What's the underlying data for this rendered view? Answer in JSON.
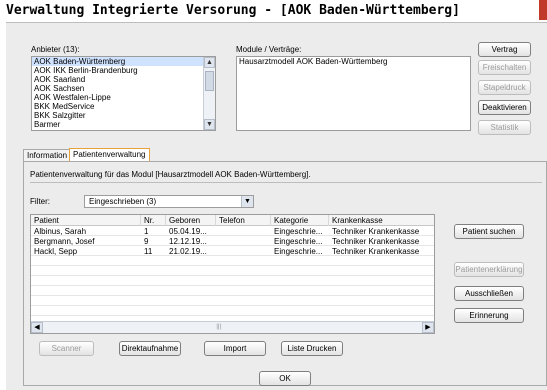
{
  "window": {
    "title": "Verwaltung Integrierte Versorung - [AOK Baden-Württemberg]"
  },
  "anbieter": {
    "label": "Anbieter (13):",
    "items": [
      "AOK Baden-Württemberg",
      "AOK IKK Berlin-Brandenburg",
      "AOK Saarland",
      "AOK Sachsen",
      "AOK Westfalen-Lippe",
      "BKK MedService",
      "BKK Salzgitter",
      "Barmer"
    ],
    "selected_index": 0
  },
  "module": {
    "label": "Module / Verträge:",
    "items": [
      "Hausarztmodell AOK Baden-Württemberg"
    ]
  },
  "right_buttons": {
    "vertrag": "Vertrag",
    "freischalten": "Freischalten",
    "stapeldruck": "Stapeldruck",
    "deaktivieren": "Deaktivieren",
    "statistik": "Statistik"
  },
  "tabs": {
    "information": "Information",
    "patientenverwaltung": "Patientenverwaltung"
  },
  "panel": {
    "description": "Patientenverwaltung für das Modul [Hausarztmodell AOK Baden-Württemberg].",
    "filter_label": "Filter:",
    "filter_value": "Eingeschrieben (3)"
  },
  "table": {
    "columns": [
      "Patient",
      "Nr.",
      "Geboren",
      "Telefon",
      "Kategorie",
      "Krankenkasse"
    ],
    "rows": [
      {
        "patient": "Albinus, Sarah",
        "nr": "1",
        "geboren": "05.04.19...",
        "telefon": "",
        "kategorie": "Eingeschrie...",
        "kasse": "Techniker Krankenkasse"
      },
      {
        "patient": "Bergmann, Josef",
        "nr": "9",
        "geboren": "12.12.19...",
        "telefon": "",
        "kategorie": "Eingeschrie...",
        "kasse": "Techniker Krankenkasse"
      },
      {
        "patient": "Hackl, Sepp",
        "nr": "11",
        "geboren": "21.02.19...",
        "telefon": "",
        "kategorie": "Eingeschrie...",
        "kasse": "Techniker Krankenkasse"
      }
    ]
  },
  "side_buttons": {
    "patient_suchen": "Patient suchen",
    "patientenerklaerung": "Patientenerklärung",
    "ausschliessen": "Ausschließen",
    "erinnerung": "Erinnerung"
  },
  "bottom_buttons": {
    "scanner": "Scanner",
    "direktaufnahme": "Direktaufnahme",
    "import": "Import",
    "liste_drucken": "Liste Drucken",
    "ok": "OK"
  },
  "colors": {
    "selection": "#cfe2ff",
    "active_tab_border": "#e8a23a",
    "disabled_text": "#9c9c9c"
  }
}
